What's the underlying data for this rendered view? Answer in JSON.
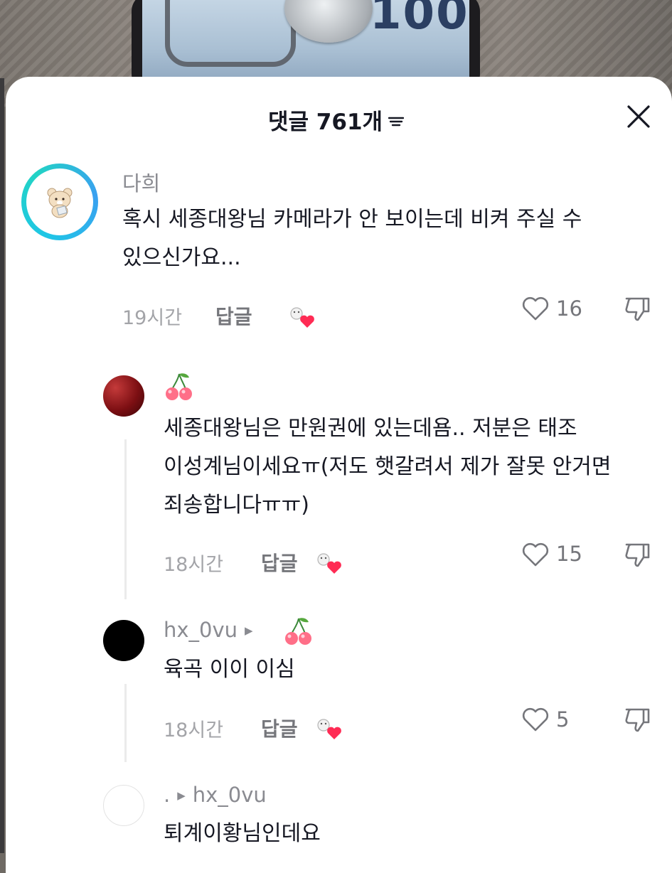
{
  "header": {
    "title": "댓글 761개"
  },
  "comments": [
    {
      "username": "다희",
      "text_line1": "혹시 세종대왕님 카메라가 안 보이는데 비켜 주실 수",
      "text_line2": "있으신가요...",
      "time": "19시간",
      "reply_label": "답글",
      "likes": "16"
    },
    {
      "username_emoji": "🍒",
      "text_line1": "세종대왕님은 만원권에 있는데욤.. 저분은 태조",
      "text_line2": "이성계님이세요ㅠ(저도 햇갈려서 제가 잘못 안거면",
      "text_line3": "죄송합니다ㅠㅠ)",
      "time": "18시간",
      "reply_label": "답글",
      "likes": "15"
    },
    {
      "username": "hx_0vu",
      "reply_to_emoji": "🍒",
      "text": "육곡 이이 이심",
      "time": "18시간",
      "reply_label": "답글",
      "likes": "5"
    },
    {
      "username": ".",
      "reply_to": "hx_0vu",
      "text": "퇴계이황님인데요"
    }
  ],
  "icons": {
    "close": "close-icon",
    "filter": "filter-icon",
    "like": "heart-outline-icon",
    "dislike": "thumbs-down-icon",
    "creator_like": "creator-liked-icon"
  },
  "colors": {
    "heart_red": "#ff2b54",
    "text_dark": "#161823",
    "text_gray": "#8a8b91"
  }
}
